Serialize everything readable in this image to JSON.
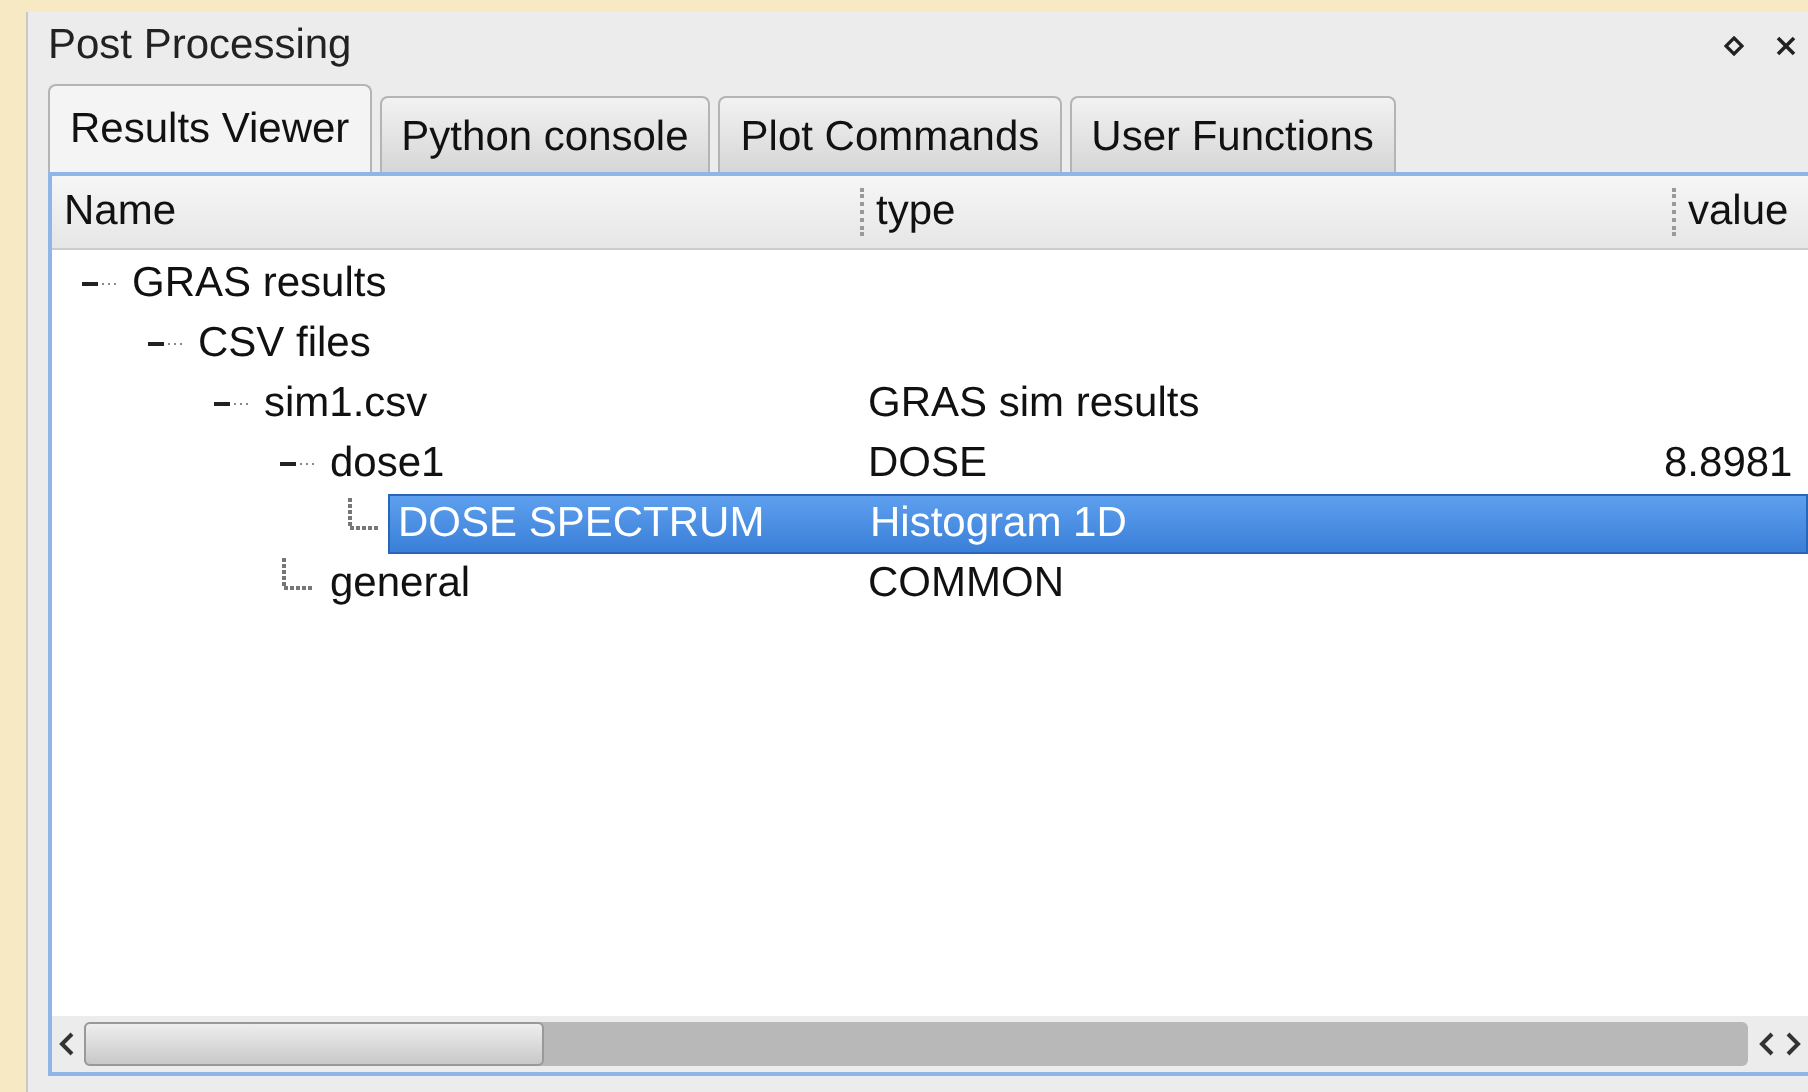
{
  "window": {
    "title": "Post Processing"
  },
  "tabs": [
    {
      "label": "Results Viewer",
      "selected": true
    },
    {
      "label": "Python console",
      "selected": false
    },
    {
      "label": "Plot Commands",
      "selected": false
    },
    {
      "label": "User Functions",
      "selected": false
    }
  ],
  "tree": {
    "columns": [
      "Name",
      "type",
      "value"
    ],
    "items": [
      {
        "name": "GRAS results",
        "expanded": true,
        "selected": false,
        "children": [
          {
            "name": "CSV files",
            "expanded": true,
            "selected": false,
            "children": [
              {
                "name": "sim1.csv",
                "type": "GRAS sim results",
                "expanded": true,
                "selected": false,
                "children": [
                  {
                    "name": "dose1",
                    "type": "DOSE",
                    "value": "8.8981",
                    "expanded": true,
                    "selected": false,
                    "children": [
                      {
                        "name": "DOSE SPECTRUM",
                        "type": "Histogram 1D",
                        "selected": true
                      }
                    ]
                  },
                  {
                    "name": "general",
                    "type": "COMMON",
                    "selected": false
                  }
                ]
              }
            ]
          }
        ]
      }
    ]
  }
}
